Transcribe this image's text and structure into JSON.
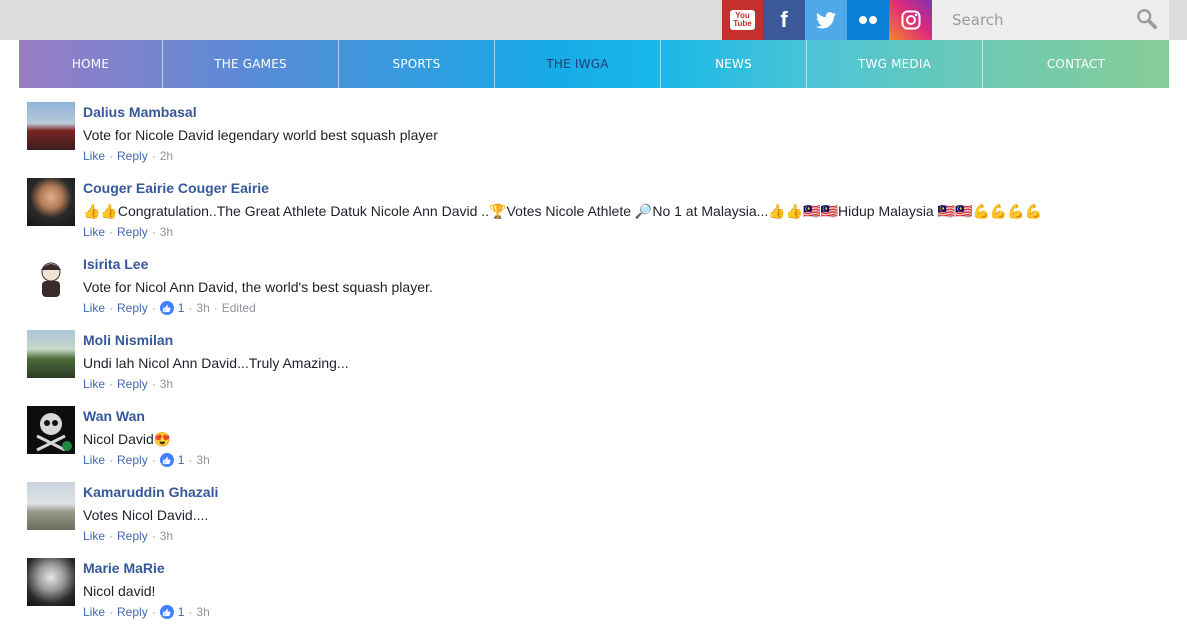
{
  "social": {
    "youtube_text_top": "You",
    "youtube_text_bottom": "Tube",
    "facebook_glyph": "f"
  },
  "search": {
    "placeholder": "Search"
  },
  "nav": {
    "items": [
      {
        "label": "HOME"
      },
      {
        "label": "THE GAMES"
      },
      {
        "label": "SPORTS"
      },
      {
        "label": "THE IWGA"
      },
      {
        "label": "NEWS"
      },
      {
        "label": "TWG MEDIA"
      },
      {
        "label": "CONTACT"
      }
    ]
  },
  "actions": {
    "like": "Like",
    "reply": "Reply",
    "dot": "·",
    "edited": "Edited"
  },
  "comments": [
    {
      "author": "Dalius Mambasal",
      "text": "Vote for Nicole David legendary world best squash player",
      "likes": "",
      "time": "2h"
    },
    {
      "author": "Couger Eairie Couger Eairie",
      "text": "👍👍Congratulation..The Great Athlete Datuk Nicole Ann David ..🏆Votes Nicole Athlete 🔎No 1 at Malaysia...👍👍🇲🇾🇲🇾Hidup Malaysia 🇲🇾🇲🇾💪💪💪💪",
      "likes": "",
      "time": "3h"
    },
    {
      "author": "Isirita Lee",
      "text": "Vote for Nicol Ann David, the world's best squash player.",
      "likes": "1",
      "time": "3h"
    },
    {
      "author": "Moli Nismilan",
      "text": "Undi lah Nicol Ann David...Truly Amazing...",
      "likes": "",
      "time": "3h"
    },
    {
      "author": "Wan Wan",
      "text": "Nicol David😍",
      "likes": "1",
      "time": "3h"
    },
    {
      "author": "Kamaruddin Ghazali",
      "text": "Votes Nicol David....",
      "likes": "",
      "time": "3h"
    },
    {
      "author": "Marie MaRie",
      "text": "Nicol david!",
      "likes": "1",
      "time": "3h"
    }
  ],
  "colors": {
    "author": "#365899",
    "link": "#4267b2",
    "meta": "#90949c",
    "like_badge": "#4080ff"
  }
}
